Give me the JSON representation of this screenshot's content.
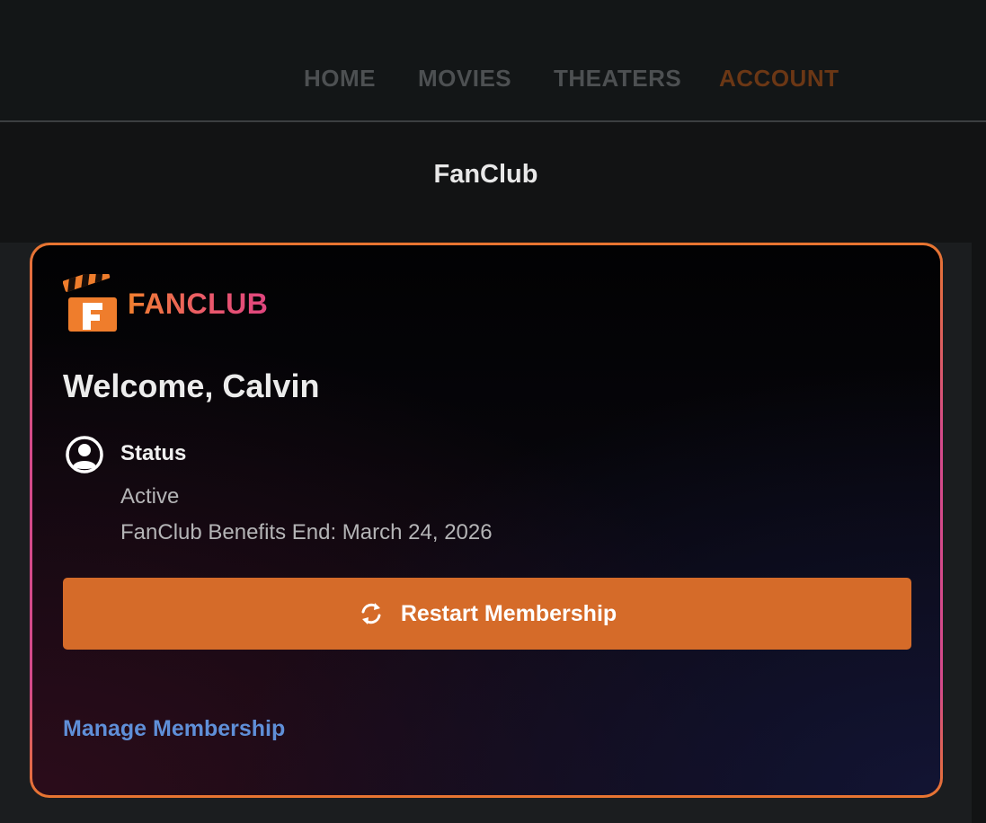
{
  "nav": {
    "items": [
      {
        "label": "HOME",
        "active": false
      },
      {
        "label": "MOVIES",
        "active": false
      },
      {
        "label": "THEATERS",
        "active": false
      },
      {
        "label": "ACCOUNT",
        "active": true
      }
    ]
  },
  "page": {
    "title": "FanClub"
  },
  "card": {
    "logo_text": "FANCLUB",
    "logo_icon": "clapperboard-f-icon",
    "welcome": "Welcome, Calvin",
    "status_icon": "user-circle-icon",
    "status_label": "Status",
    "status_value": "Active",
    "benefits_end": "FanClub Benefits End: March 24, 2026",
    "restart_button": {
      "icon": "refresh-icon",
      "label": "Restart Membership"
    },
    "manage_link": "Manage Membership"
  },
  "colors": {
    "accent_orange": "#d56b29",
    "active_nav": "#6b3715",
    "link_blue": "#5f8fd8",
    "card_border_pink": "#d44a8a"
  }
}
